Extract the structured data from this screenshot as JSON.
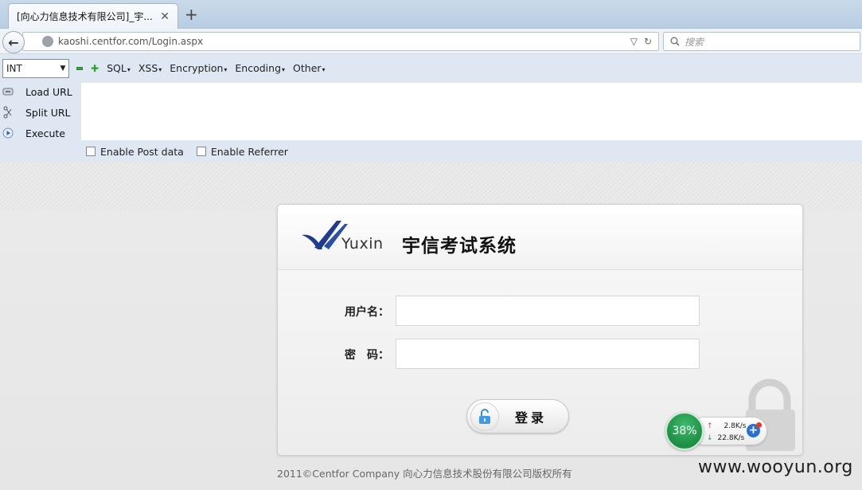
{
  "browser": {
    "tab_title": "[向心力信息技术有限公司]_宇...",
    "tab_close": "✕",
    "new_tab": "+",
    "url": "kaoshi.centfor.com/Login.aspx",
    "search_placeholder": "搜索"
  },
  "hackbar": {
    "select_value": "INT",
    "menus": [
      "SQL",
      "XSS",
      "Encryption",
      "Encoding",
      "Other"
    ],
    "actions": {
      "load": "Load URL",
      "split": "Split URL",
      "execute": "Execute"
    },
    "options": {
      "post": "Enable Post data",
      "referrer": "Enable Referrer"
    }
  },
  "login": {
    "logo_text": "Yuxin",
    "system_title": "宇信考试系统",
    "username_label": "用户名：",
    "password_label": "密　码：",
    "login_button": "登录",
    "copyright": "2011©Centfor Company 向心力信息技术股份有限公司版权所有"
  },
  "speed_widget": {
    "percent": "38%",
    "upload": "2.8K/s",
    "download": "22.8K/s"
  },
  "watermark": "www.wooyun.org",
  "colors": {
    "logo_blue": "#1f3c8f",
    "speed_green": "#1d8e45"
  }
}
